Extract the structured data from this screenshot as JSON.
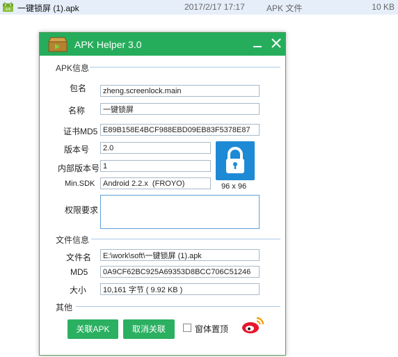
{
  "file_row": {
    "name": "一键锁屏 (1).apk",
    "date": "2017/2/17 17:17",
    "type": "APK 文件",
    "size": "10 KB"
  },
  "window": {
    "title": "APK Helper 3.0"
  },
  "apk_info": {
    "section_title": "APK信息",
    "package_label": "包名",
    "package_value": "zheng.screenlock.main",
    "name_label": "名称",
    "name_value": "一键锁屏",
    "cert_label": "证书MD5",
    "cert_value": "E89B158E4BCF988EBD09EB83F5378E87",
    "version_label": "版本号",
    "version_value": "2.0",
    "internal_version_label": "内部版本号",
    "internal_version_value": "1",
    "minsdk_label": "Min.SDK",
    "minsdk_value": "Android 2.2.x  (FROYO)",
    "icon_size": "96 x 96",
    "permissions_label": "权限要求",
    "permissions_value": ""
  },
  "file_info": {
    "section_title": "文件信息",
    "filename_label": "文件名",
    "filename_value": "E:\\work\\soft\\一键锁屏 (1).apk",
    "md5_label": "MD5",
    "md5_value": "0A9CF62BC925A69353D8BCC706C51246",
    "size_label": "大小",
    "size_value": "10,161 字节 ( 9.92 KB )"
  },
  "other": {
    "section_title": "其他",
    "associate_button": "关联APK",
    "unassociate_button": "取消关联",
    "topmost_label": "窗体置顶",
    "topmost_checked": false
  },
  "colors": {
    "titlebar": "#26ad5c",
    "button": "#2bb061",
    "lock_tile": "#1e8ad6"
  }
}
